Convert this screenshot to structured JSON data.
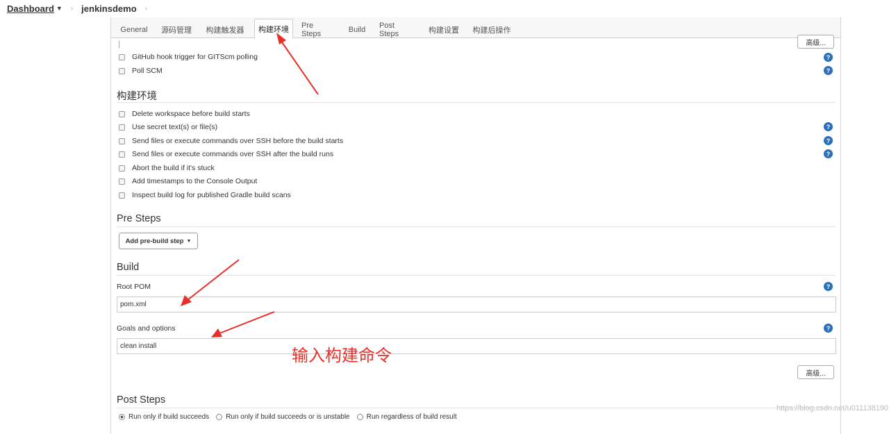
{
  "breadcrumb": {
    "root": "Dashboard",
    "job": "jenkinsdemo"
  },
  "tabs": [
    "General",
    "源码管理",
    "构建触发器",
    "构建环境",
    "Pre Steps",
    "Build",
    "Post Steps",
    "构建设置",
    "构建后操作"
  ],
  "active_tab": "构建环境",
  "advanced_label": "高级...",
  "triggers": {
    "items": [
      "GitHub hook trigger for GITScm polling",
      "Poll SCM"
    ]
  },
  "build_env": {
    "title": "构建环境",
    "items": [
      "Delete workspace before build starts",
      "Use secret text(s) or file(s)",
      "Send files or execute commands over SSH before the build starts",
      "Send files or execute commands over SSH after the build runs",
      "Abort the build if it's stuck",
      "Add timestamps to the Console Output",
      "Inspect build log for published Gradle build scans"
    ]
  },
  "pre_steps": {
    "title": "Pre Steps",
    "add_button": "Add pre-build step"
  },
  "build": {
    "title": "Build",
    "root_pom_label": "Root POM",
    "root_pom_value": "pom.xml",
    "goals_label": "Goals and options",
    "goals_value": "clean install"
  },
  "annotation": "输入构建命令",
  "post_steps": {
    "title": "Post Steps",
    "options": [
      "Run only if build succeeds",
      "Run only if build succeeds or is unstable",
      "Run regardless of build result"
    ]
  },
  "watermark": "https://blog.csdn.net/u011138190",
  "help_glyph": "?",
  "colors": {
    "help_icon": "#2a6fb7",
    "annotation": "#e8302a"
  }
}
